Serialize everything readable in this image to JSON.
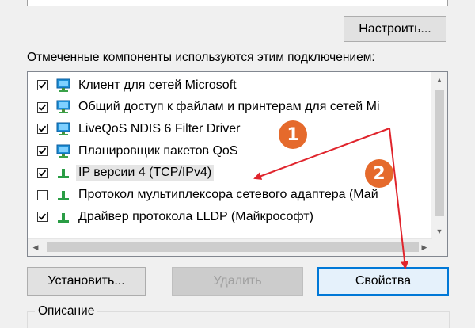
{
  "configure_button": "Настроить...",
  "components_label": "Отмеченные компоненты используются этим подключением:",
  "components": [
    {
      "label": "Клиент для сетей Microsoft",
      "checked": true,
      "icon": "network-client-icon"
    },
    {
      "label": "Общий доступ к файлам и принтерам для сетей Mi",
      "checked": true,
      "icon": "network-service-icon"
    },
    {
      "label": "LiveQoS NDIS 6 Filter Driver",
      "checked": true,
      "icon": "network-service-icon"
    },
    {
      "label": "Планировщик пакетов QoS",
      "checked": true,
      "icon": "network-service-icon"
    },
    {
      "label": "IP версии 4 (TCP/IPv4)",
      "checked": true,
      "icon": "protocol-icon",
      "selected": true
    },
    {
      "label": "Протокол мультиплексора сетевого адаптера (Май",
      "checked": false,
      "icon": "protocol-icon"
    },
    {
      "label": "Драйвер протокола LLDP (Майкрософт)",
      "checked": true,
      "icon": "protocol-icon"
    }
  ],
  "buttons": {
    "install": "Установить...",
    "remove": "Удалить",
    "properties": "Свойства"
  },
  "description_label": "Описание",
  "annotations": [
    {
      "number": "1",
      "color": "#e56a2c"
    },
    {
      "number": "2",
      "color": "#e56a2c"
    }
  ],
  "colors": {
    "arrow": "#e0242c",
    "focus_border": "#0078d7"
  }
}
